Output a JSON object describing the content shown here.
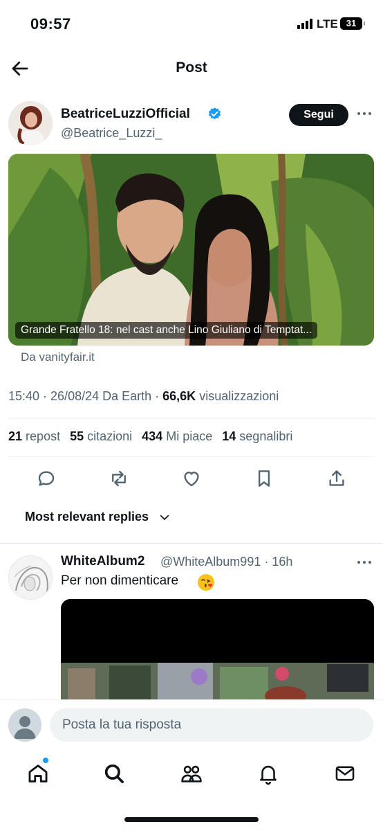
{
  "status_bar": {
    "time": "09:57",
    "network": "LTE",
    "battery": "31"
  },
  "nav": {
    "title": "Post"
  },
  "post": {
    "author_name": "BeatriceLuzziOfficial",
    "author_handle": "@Beatrice_Luzzi_",
    "follow_label": "Segui",
    "card_caption": "Grande Fratello 18: nel cast anche Lino Giuliano di Temptat...",
    "card_source": "Da vanityfair.it",
    "timestamp": "15:40 · 26/08/24 Da Earth · ",
    "views_count": "66,6K",
    "views_label": " visualizzazioni",
    "stats": {
      "reposts_count": "21",
      "reposts_label": "repost",
      "quotes_count": "55",
      "quotes_label": "citazioni",
      "likes_count": "434",
      "likes_label": "Mi piace",
      "bookmarks_count": "14",
      "bookmarks_label": "segnalibri"
    }
  },
  "replies": {
    "filter_label": "Most relevant replies",
    "items": [
      {
        "name": "WhiteAlbum2",
        "handle": "@WhiteAlbum991 · 16h",
        "text": "Per non dimenticare"
      }
    ]
  },
  "compose": {
    "placeholder": "Posta la tua risposta"
  },
  "colors": {
    "accent": "#1d9bf0",
    "text_primary": "#0f1419",
    "text_secondary": "#536471"
  },
  "icons": {
    "back": "arrow-left-icon",
    "verified": "verified-badge-icon",
    "more": "more-horizontal-icon",
    "reply": "reply-icon",
    "repost": "repost-icon",
    "like": "heart-icon",
    "bookmark": "bookmark-icon",
    "share": "share-icon",
    "tabs": [
      "home-icon",
      "search-icon",
      "communities-icon",
      "notifications-icon",
      "messages-icon"
    ]
  }
}
